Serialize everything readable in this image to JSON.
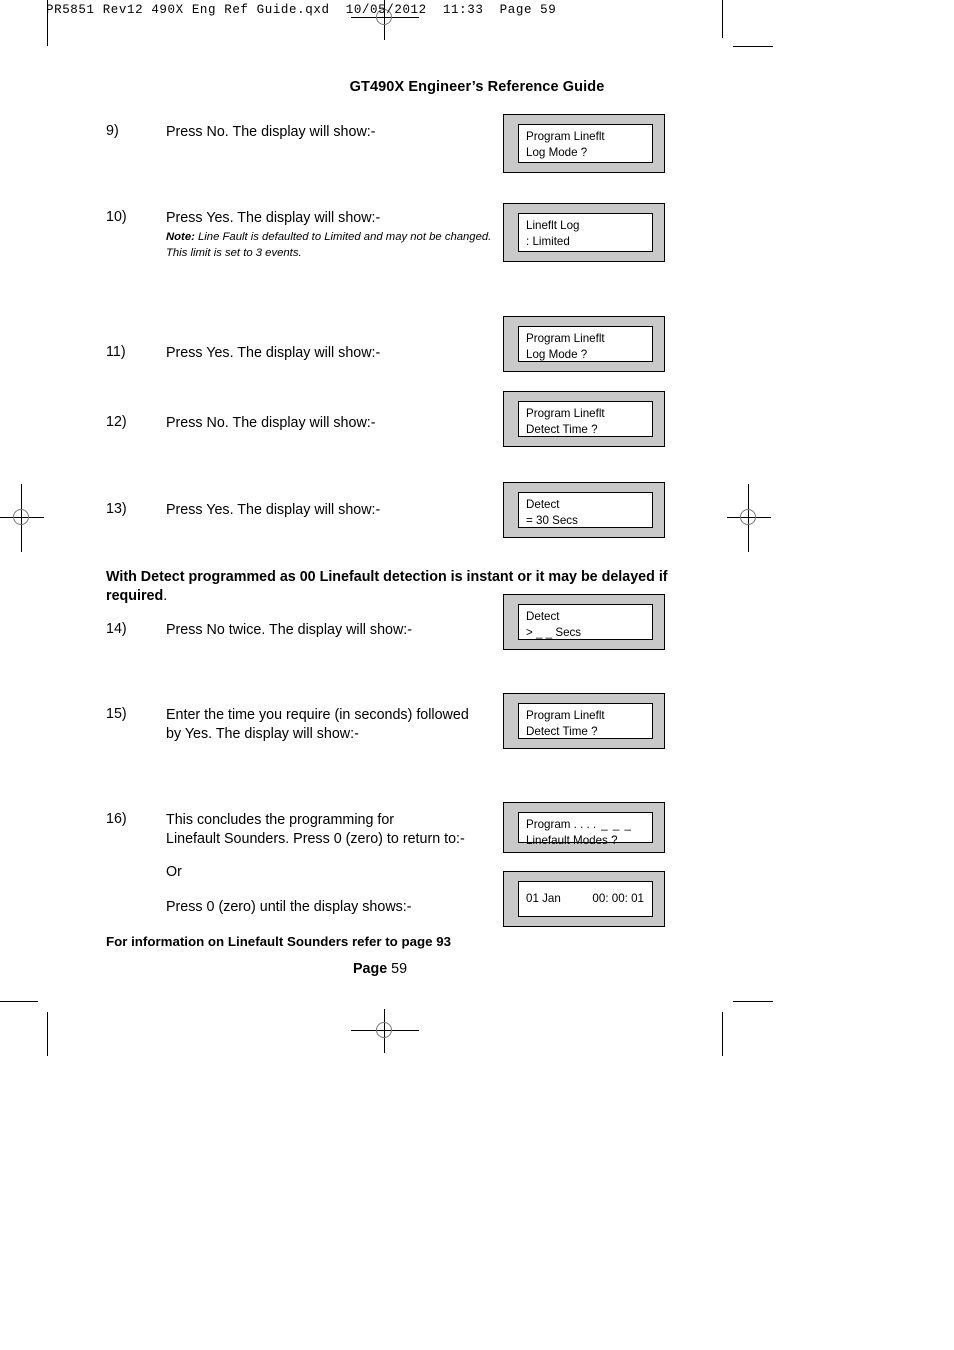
{
  "slug": "PR5851 Rev12 490X Eng Ref Guide.qxd  10/05/2012  11:33  Page 59",
  "header": {
    "title": "GT490X Engineer’s Reference Guide"
  },
  "steps": [
    {
      "number": "9)",
      "text": "Press No. The display will show:-"
    },
    {
      "number": "10)",
      "text": "Press Yes. The display will show:-",
      "note_label": "Note:",
      "note_text": " Line Fault is defaulted to Limited and may not be changed.",
      "note_text2": "This limit is set to 3 events."
    },
    {
      "number": "11)",
      "text": "Press Yes. The display will show:-"
    },
    {
      "number": "12)",
      "text": "Press No. The display will show:-"
    },
    {
      "number": "13)",
      "text": "Press Yes. The display will show:-"
    },
    {
      "number": "14)",
      "text": "Press No twice. The display will show:-"
    },
    {
      "number": "15)",
      "text_line1": "Enter the time you require (in seconds) followed",
      "text_line2": "by Yes. The display will show:-"
    },
    {
      "number": "16)",
      "text_line1": "This concludes the programming for",
      "text_line2": "Linefault Sounders. Press 0 (zero) to return to:-",
      "or_text": "Or",
      "tail_text": "Press 0 (zero) until the display shows:-"
    }
  ],
  "bold_paragraph": {
    "line1": "With Detect programmed as 00 Linefault detection is instant or it may be delayed",
    "line2": "if required",
    "line2_tail": "."
  },
  "footer_note": "For information on Linefault Sounders refer to page 93",
  "page_number": {
    "label": "Page",
    "value": "59"
  },
  "displays": [
    {
      "id": "display-program-lineflt-log-mode-1",
      "line1": "Program Lineflt",
      "line2": "Log Mode ?"
    },
    {
      "id": "display-lineflt-log-limited",
      "line1": "Lineflt Log",
      "line2": ": Limited"
    },
    {
      "id": "display-program-lineflt-log-mode-2",
      "line1": "Program Lineflt",
      "line2": "Log Mode ?"
    },
    {
      "id": "display-program-lineflt-detect-time-1",
      "line1": "Program Lineflt",
      "line2": "Detect Time ?"
    },
    {
      "id": "display-detect-30-secs",
      "line1": "Detect",
      "line2": "= 30 Secs"
    },
    {
      "id": "display-detect-blank-secs",
      "line1": "Detect",
      "line2": "> _ _ Secs"
    },
    {
      "id": "display-program-lineflt-detect-time-2",
      "line1": "Program Lineflt",
      "line2": "Detect Time ?"
    },
    {
      "id": "display-program-linefault-modes",
      "line1": "Program . . . .",
      "line1_right": "_ _ _",
      "line2": "Linefault Modes ?"
    },
    {
      "id": "display-clock",
      "date": "01 Jan",
      "time": "00: 00: 01"
    }
  ],
  "colors": {
    "bezel": "#c9c9c9",
    "screen": "#ffffff",
    "ink": "#000000"
  }
}
